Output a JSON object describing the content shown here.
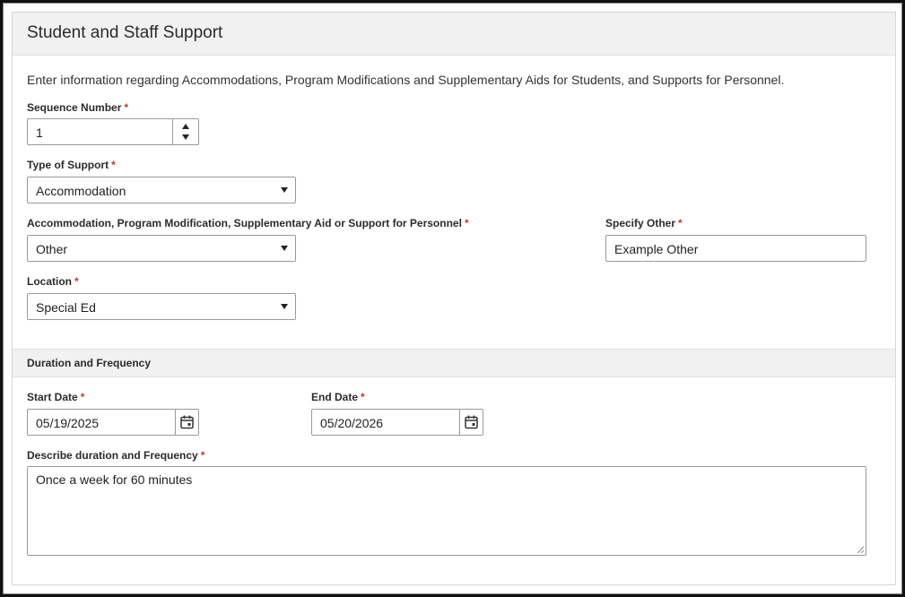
{
  "panel": {
    "title": "Student and Staff Support",
    "intro": "Enter information regarding Accommodations, Program Modifications and Supplementary Aids for Students, and Supports for Personnel."
  },
  "required_mark": "*",
  "fields": {
    "sequence_number": {
      "label": "Sequence Number",
      "value": "1"
    },
    "type_of_support": {
      "label": "Type of Support",
      "value": "Accommodation"
    },
    "accommodation": {
      "label": "Accommodation, Program Modification, Supplementary Aid or Support for Personnel",
      "value": "Other"
    },
    "specify_other": {
      "label": "Specify Other",
      "value": "Example Other"
    },
    "location": {
      "label": "Location",
      "value": "Special Ed"
    }
  },
  "duration": {
    "section_title": "Duration and Frequency",
    "start_date": {
      "label": "Start Date",
      "value": "05/19/2025"
    },
    "end_date": {
      "label": "End Date",
      "value": "05/20/2026"
    },
    "description": {
      "label": "Describe duration and Frequency",
      "value": "Once a week for 60 minutes"
    }
  },
  "icons": {
    "calendar": "calendar-icon",
    "dropdown": "chevron-down-icon",
    "stepper": "spin-arrows-icon"
  },
  "colors": {
    "required": "#c0392b",
    "header_bg": "#f1f1f1",
    "border": "#9a9a9a"
  }
}
